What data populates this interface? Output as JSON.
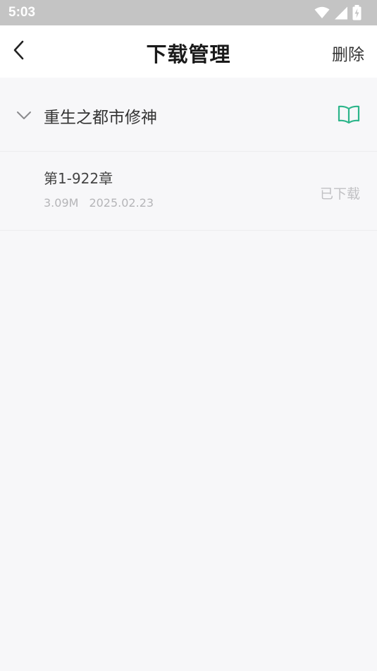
{
  "status_bar": {
    "time": "5:03",
    "icons": [
      "wifi-icon",
      "cellular-signal-icon",
      "battery-charging-icon"
    ]
  },
  "header": {
    "title": "下载管理",
    "delete_label": "删除",
    "back_icon": "chevron-left-icon"
  },
  "book": {
    "title": "重生之都市修神",
    "expanded": true,
    "read_icon": "open-book-icon",
    "accent_color": "#2cb58a"
  },
  "chapters": [
    {
      "range": "第1-922章",
      "size": "3.09M",
      "date": "2025.02.23",
      "status": "已下载"
    }
  ],
  "colors": {
    "status_bar_bg": "#c4c4c4",
    "page_bg": "#f7f7f9",
    "header_bg": "#ffffff"
  }
}
